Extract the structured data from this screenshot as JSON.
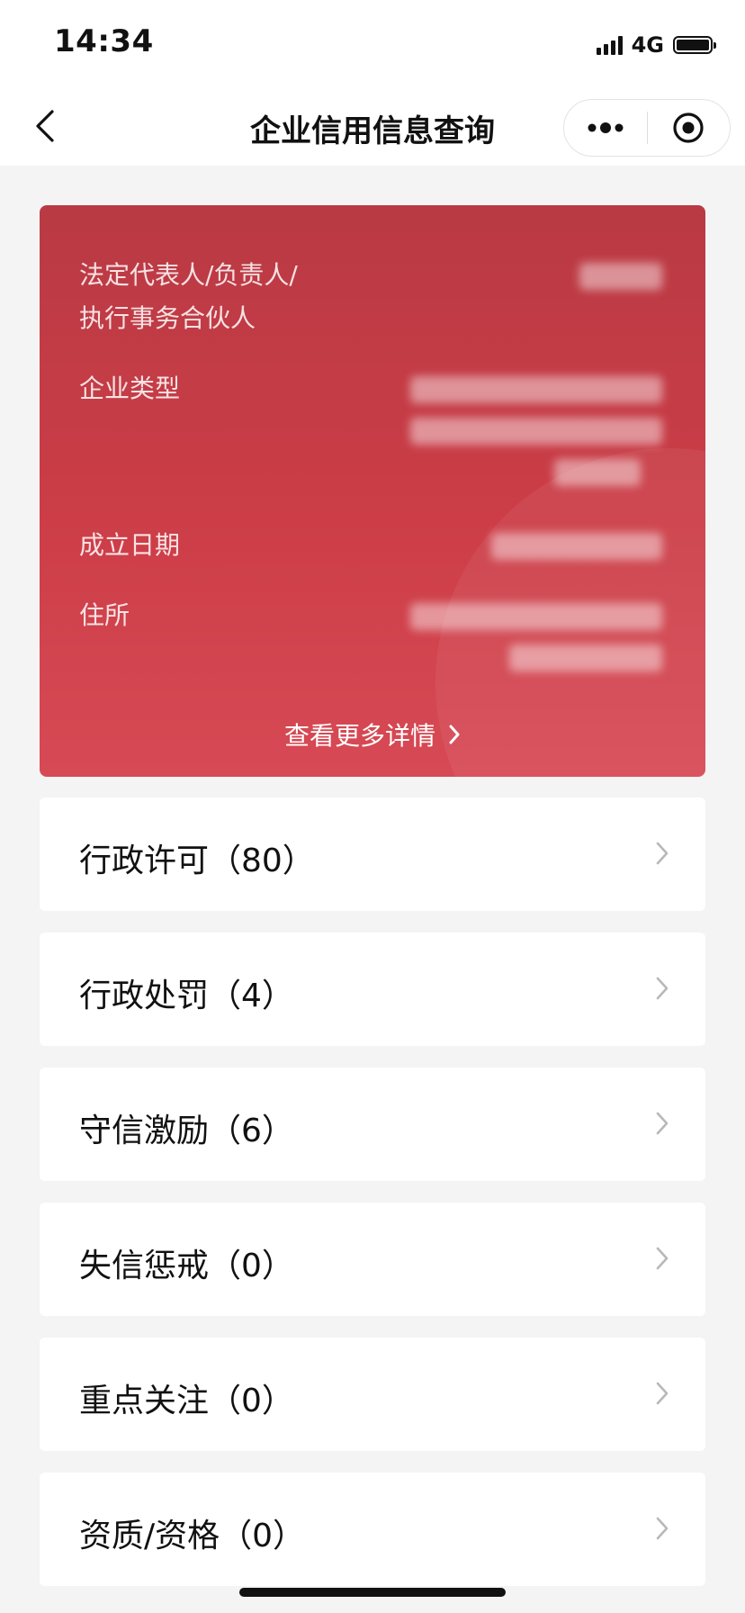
{
  "status_bar": {
    "time": "14:34",
    "network": "4G"
  },
  "nav": {
    "title": "企业信用信息查询"
  },
  "info_card": {
    "legal_rep_label_line1": "法定代表人/负责人/",
    "legal_rep_label_line2": "执行事务合伙人",
    "company_type_label": "企业类型",
    "established_date_label": "成立日期",
    "address_label": "住所",
    "more_details_label": "查看更多详情",
    "background_color": "#cc3d47"
  },
  "list": {
    "items": [
      {
        "label": "行政许可（80）"
      },
      {
        "label": "行政处罚（4）"
      },
      {
        "label": "守信激励（6）"
      },
      {
        "label": "失信惩戒（0）"
      },
      {
        "label": "重点关注（0）"
      },
      {
        "label": "资质/资格（0）"
      }
    ]
  }
}
